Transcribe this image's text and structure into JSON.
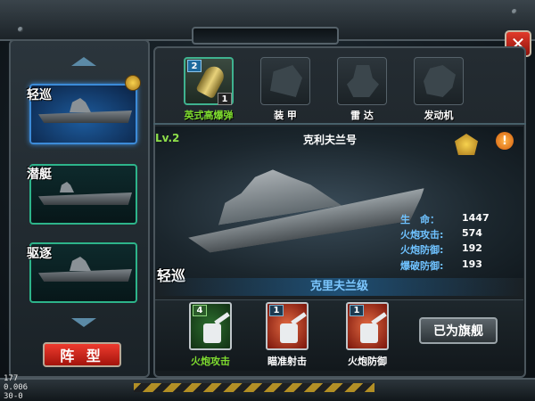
{
  "window": {
    "close_label": "✕"
  },
  "sidebar": {
    "ships": [
      {
        "type": "轻巡",
        "selected": true
      },
      {
        "type": "潜艇",
        "selected": false
      },
      {
        "type": "驱逐",
        "selected": false
      }
    ],
    "formation_button": "阵 型"
  },
  "equipment": [
    {
      "label": "英式高爆弹",
      "count_top": "2",
      "count_bottom": "1",
      "icon": "he-shell-icon",
      "active": true
    },
    {
      "label": "装 甲",
      "icon": "armor-icon",
      "active": false
    },
    {
      "label": "雷 达",
      "icon": "radar-icon",
      "active": false
    },
    {
      "label": "发动机",
      "icon": "engine-icon",
      "active": false
    }
  ],
  "ship": {
    "level": "Lv.2",
    "name": "克利夫兰号",
    "type_badge": "轻巡",
    "class_name": "克里夫兰级",
    "stats": [
      {
        "label": "生　命：",
        "value": "1447"
      },
      {
        "label": "火炮攻击:",
        "value": "574"
      },
      {
        "label": "火炮防御:",
        "value": "192"
      },
      {
        "label": "爆破防御:",
        "value": "193"
      }
    ]
  },
  "skills": [
    {
      "level": "4",
      "label": "火炮攻击",
      "style": "green",
      "label_color": "#7fdc2f"
    },
    {
      "level": "1",
      "label": "瞄准射击",
      "style": "red",
      "label_color": "#ffffff"
    },
    {
      "level": "1",
      "label": "火炮防御",
      "style": "red",
      "label_color": "#ffffff"
    }
  ],
  "flagship_button": "已为旗舰",
  "debug": {
    "line1": "177",
    "line2": "0.006",
    "line3": "30-0"
  },
  "colors": {
    "accent_green": "#7fdc2f",
    "accent_red": "#e23a2a",
    "stat_blue": "#6fc2ff"
  }
}
